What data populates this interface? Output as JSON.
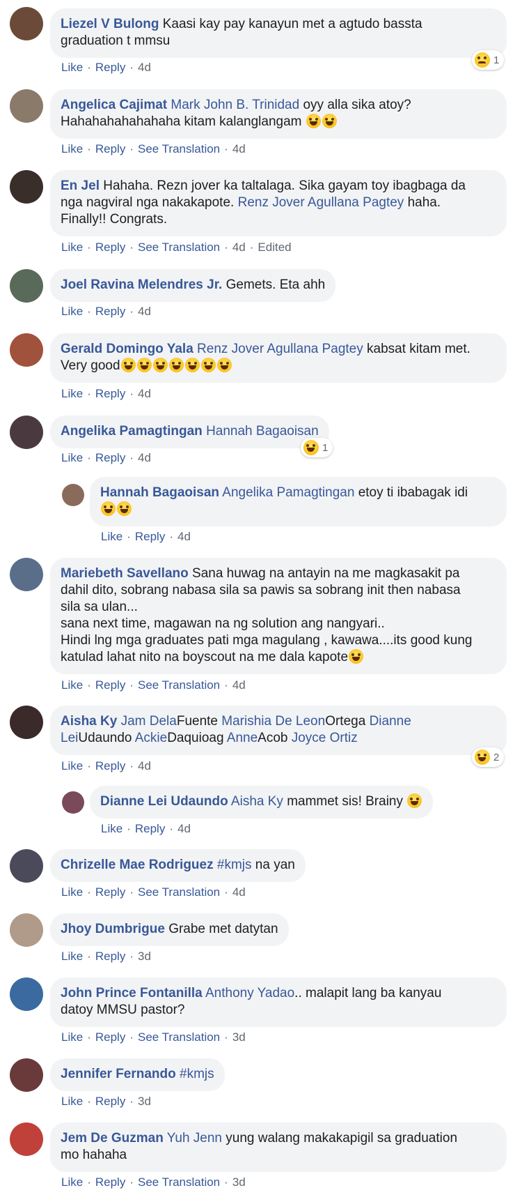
{
  "common": {
    "like": "Like",
    "reply": "Reply",
    "see_translation": "See Translation",
    "edited": "Edited"
  },
  "comments": [
    {
      "author": "Liezel V Bulong",
      "text_a": "Kaasi kay pay kanayun met a agtudo bassta",
      "text_b": "graduation t mmsu",
      "time": "4d",
      "reaction_count": "1",
      "reaction_icon": "sad-face-icon"
    },
    {
      "author": "Angelica Cajimat",
      "mention": "Mark John B. Trinidad",
      "text_a": "oyy alla sika atoy?",
      "text_b": "Hahahahahahahaha kitam kalanglangam",
      "time": "4d"
    },
    {
      "author": "En Jel",
      "text_a": "Hahaha. Rezn jover ka taltalaga. Sika gayam toy ibagbaga da",
      "text_b": "nga nagviral nga nakakapote.",
      "mention": "Renz Jover Agullana Pagtey",
      "text_c": "haha.",
      "text_d": "Finally!! Congrats.",
      "time": "4d"
    },
    {
      "author": "Joel Ravina Melendres Jr.",
      "text_a": "Gemets. Eta ahh",
      "time": "4d"
    },
    {
      "author": "Gerald Domingo Yala",
      "mention": "Renz Jover Agullana Pagtey",
      "text_a": "kabsat kitam met.",
      "text_b": "Very good",
      "time": "4d"
    },
    {
      "author": "Angelika Pamagtingan",
      "mention": "Hannah Bagaoisan",
      "time": "4d",
      "reaction_count": "1",
      "reaction_icon": "laughing-face-icon"
    },
    {
      "author": "Hannah Bagaoisan",
      "mention": "Angelika Pamagtingan",
      "text_a": "etoy ti ibabagak idi",
      "time": "4d"
    },
    {
      "author": "Mariebeth Savellano",
      "text_a": "Sana huwag na antayin na me magkasakit pa",
      "text_b": "dahil dito, sobrang nabasa sila sa pawis sa sobrang init then nabasa",
      "text_c": "sila sa ulan...",
      "text_d": "sana next time, magawan na ng solution ang nangyari..",
      "text_e": "Hindi lng mga graduates pati mga magulang , kawawa....its good kung",
      "text_f": "katulad lahat nito na boyscout na me dala kapote",
      "time": "4d"
    },
    {
      "author": "Aisha Ky",
      "m1": "Jam Dela",
      "t1": "Fuente",
      "m2": "Marishia De Leon",
      "t2": "Ortega",
      "m3": "Dianne",
      "m4": "Lei",
      "t3": "Udaundo",
      "m5": "Ackie",
      "t4": "Daquioag",
      "m6": "Anne",
      "t5": "Acob",
      "m7": "Joyce Ortiz",
      "time": "4d",
      "reaction_count": "2",
      "reaction_icon": "laughing-face-icon"
    },
    {
      "author": "Dianne Lei Udaundo",
      "mention": "Aisha Ky",
      "text_a": "mammet sis! Brainy",
      "time": "4d"
    },
    {
      "author": "Chrizelle Mae Rodriguez",
      "mention": "#kmjs",
      "text_a": "na yan",
      "time": "4d"
    },
    {
      "author": "Jhoy Dumbrigue",
      "text_a": "Grabe met datytan",
      "time": "3d"
    },
    {
      "author": "John Prince Fontanilla",
      "mention": "Anthony Yadao",
      "text_a": ".. malapit lang ba kanyau",
      "text_b": "datoy MMSU pastor?",
      "time": "3d"
    },
    {
      "author": "Jennifer Fernando",
      "mention": "#kmjs",
      "time": "3d"
    },
    {
      "author": "Jem De Guzman",
      "mention": "Yuh Jenn",
      "text_a": "yung walang makakapigil sa graduation",
      "text_b": "mo hahaha",
      "time": "3d"
    }
  ],
  "avatar_colors": [
    "#6b4a3a",
    "#8a7a6a",
    "#3a2e2a",
    "#5a6a5a",
    "#a0523c",
    "#4a3a40",
    "#8a6a5a",
    "#5a6e8a",
    "#3a2a2a",
    "#7a4a5a",
    "#4a4a5a",
    "#b09a8a",
    "#3a6aa0",
    "#6a3a3a",
    "#c0403a"
  ]
}
